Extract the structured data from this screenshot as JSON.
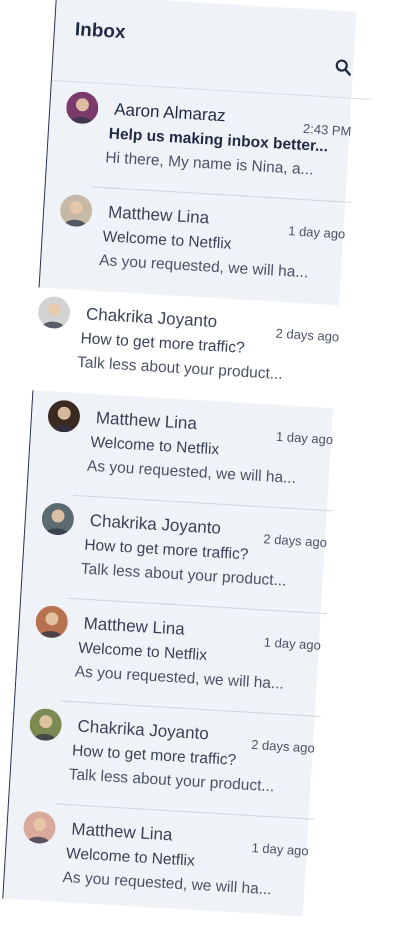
{
  "header": {
    "title": "Inbox",
    "search_icon": "search-icon"
  },
  "messages": [
    {
      "sender": "Aaron Almaraz",
      "time": "2:43 PM",
      "subject": "Help us making inbox better...",
      "preview": "Hi there, My name is Nina, a...",
      "unread": true,
      "avatar_color": "#7a3a6c"
    },
    {
      "sender": "Matthew Lina",
      "time": "1 day ago",
      "subject": "Welcome to Netflix",
      "preview": "As you requested, we will ha...",
      "unread": false,
      "avatar_color": "#c7b9a8"
    },
    {
      "sender": "Chakrika Joyanto",
      "time": "2 days ago",
      "subject": "How to get more traffic?",
      "preview": "Talk less about your product...",
      "unread": false,
      "avatar_color": "#d3d3d3"
    },
    {
      "sender": "Matthew Lina",
      "time": "1 day ago",
      "subject": "Welcome to Netflix",
      "preview": "As you requested, we will ha...",
      "unread": false,
      "avatar_color": "#3b2a22"
    },
    {
      "sender": "Chakrika Joyanto",
      "time": "2 days ago",
      "subject": "How to get more traffic?",
      "preview": "Talk less about your product...",
      "unread": false,
      "avatar_color": "#5b6b72"
    },
    {
      "sender": "Matthew Lina",
      "time": "1 day ago",
      "subject": "Welcome to Netflix",
      "preview": "As you requested, we will ha...",
      "unread": false,
      "avatar_color": "#b8724e"
    },
    {
      "sender": "Chakrika Joyanto",
      "time": "2 days ago",
      "subject": "How to get more traffic?",
      "preview": "Talk less about your product...",
      "unread": false,
      "avatar_color": "#7c8a52"
    },
    {
      "sender": "Matthew Lina",
      "time": "1 day ago",
      "subject": "Welcome to Netflix",
      "preview": "As you requested, we will ha...",
      "unread": false,
      "avatar_color": "#d9a99b"
    }
  ],
  "colors": {
    "panel_bg": "#eff2f7",
    "highlight_row_bg": "#ffffff",
    "text_dark": "#1f2a44",
    "text_muted": "#4b5368"
  }
}
